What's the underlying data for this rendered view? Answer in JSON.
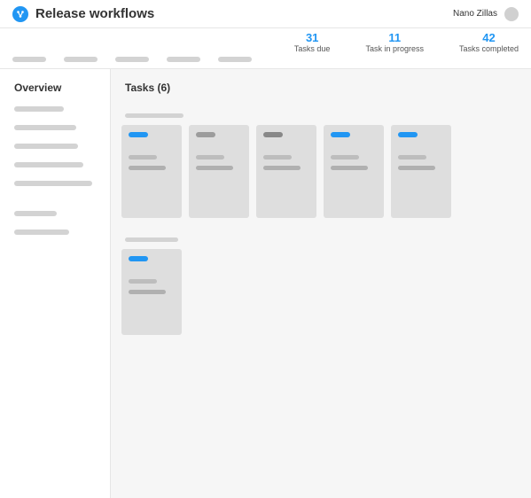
{
  "header": {
    "title": "Release workflows",
    "user": "Nano Zillas"
  },
  "stats": [
    {
      "value": "31",
      "label": "Tasks due"
    },
    {
      "value": "11",
      "label": "Task in progress"
    },
    {
      "value": "42",
      "label": "Tasks completed"
    }
  ],
  "sidebar": {
    "title": "Overview"
  },
  "main": {
    "title": "Tasks (6)"
  },
  "tabs_widths": [
    38,
    38,
    38,
    38,
    38
  ],
  "sidebar_placeholders": [
    56,
    70,
    72,
    78,
    88,
    48,
    62
  ],
  "groups": [
    {
      "label_width": 66,
      "card_height": "tall",
      "cards": [
        {
          "pill": "blue"
        },
        {
          "pill": "grey1"
        },
        {
          "pill": "grey2"
        },
        {
          "pill": "blue"
        },
        {
          "pill": "blue"
        }
      ]
    },
    {
      "label_width": 60,
      "card_height": "short",
      "cards": [
        {
          "pill": "blue"
        }
      ]
    }
  ]
}
